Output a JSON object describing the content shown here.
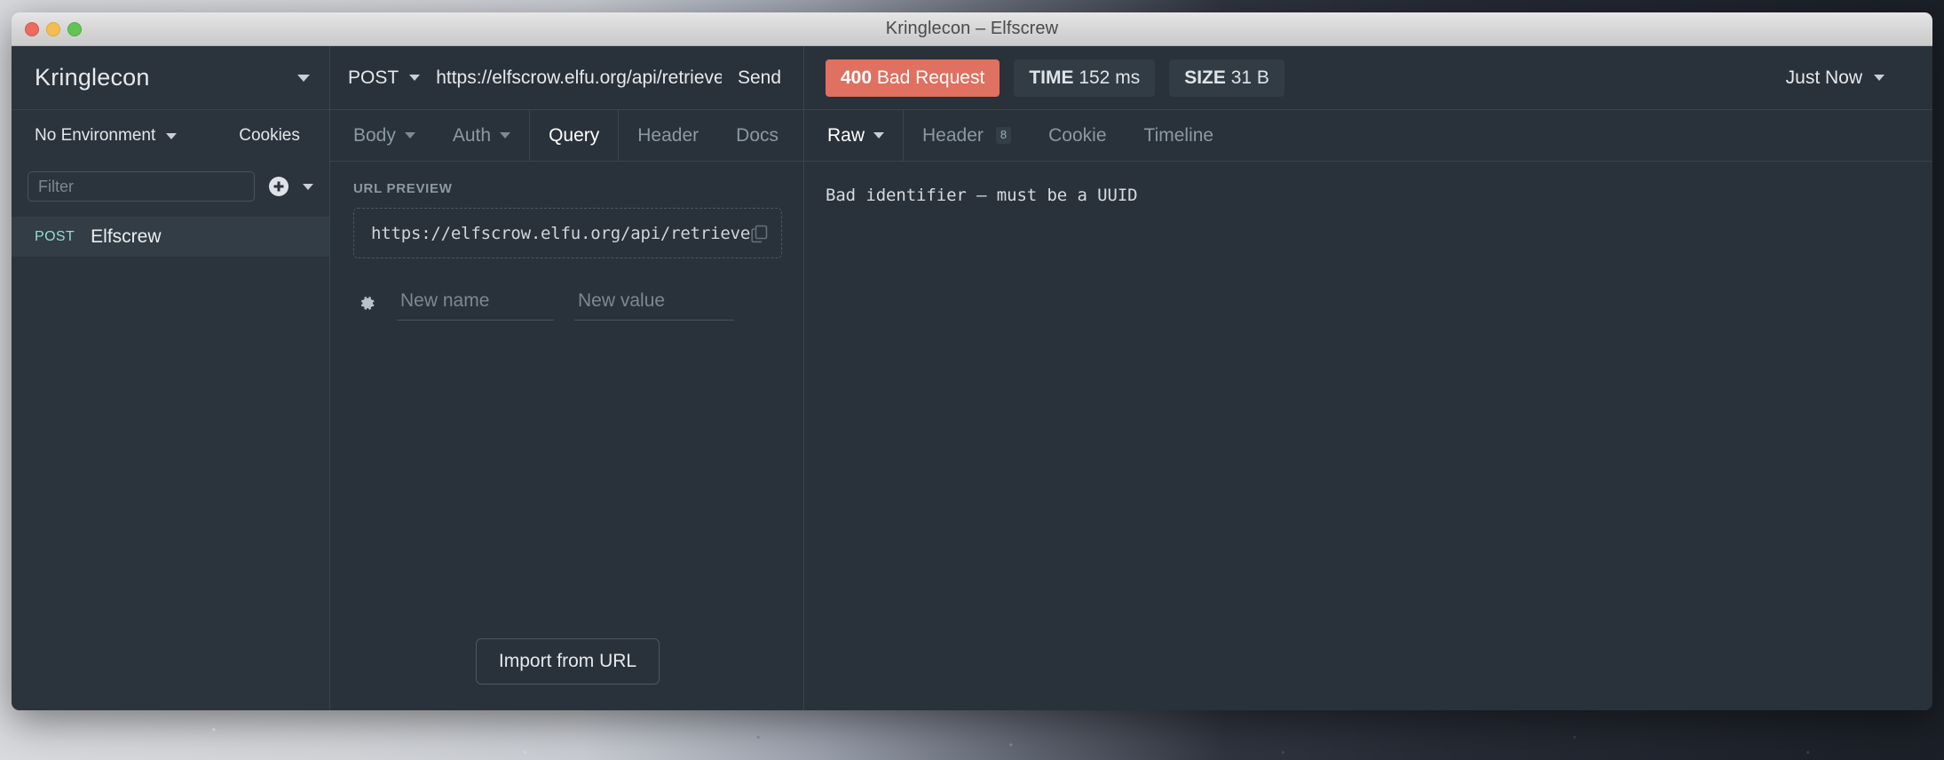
{
  "window": {
    "title": "Kringlecon – Elfscrew",
    "traffic_lights": [
      "close",
      "minimize",
      "zoom"
    ]
  },
  "sidebar": {
    "workspace_name": "Kringlecon",
    "environment": "No Environment",
    "cookies_label": "Cookies",
    "filter_placeholder": "Filter",
    "filter_value": "",
    "requests": [
      {
        "method": "POST",
        "name": "Elfscrew",
        "active": true
      }
    ]
  },
  "request": {
    "method": "POST",
    "url": "https://elfscrow.elfu.org/api/retrieve",
    "send_label": "Send",
    "tabs": [
      {
        "label": "Body",
        "caret": true,
        "active": false
      },
      {
        "label": "Auth",
        "caret": true,
        "active": false
      },
      {
        "label": "Query",
        "caret": false,
        "active": true
      },
      {
        "label": "Header",
        "caret": false,
        "active": false
      },
      {
        "label": "Docs",
        "caret": false,
        "active": false
      }
    ],
    "url_preview_label": "URL PREVIEW",
    "url_preview": "https://elfscrow.elfu.org/api/retrieve",
    "param_name_placeholder": "New name",
    "param_name_value": "",
    "param_value_placeholder": "New value",
    "param_value_value": "",
    "import_button": "Import from URL"
  },
  "response": {
    "status_code": "400",
    "status_text": "Bad Request",
    "time_label": "TIME",
    "time_value": "152 ms",
    "size_label": "SIZE",
    "size_value": "31 B",
    "history_label": "Just Now",
    "tabs": [
      {
        "label": "Raw",
        "caret": true,
        "active": true,
        "badge": ""
      },
      {
        "label": "Header",
        "caret": false,
        "active": false,
        "badge": "8"
      },
      {
        "label": "Cookie",
        "caret": false,
        "active": false,
        "badge": ""
      },
      {
        "label": "Timeline",
        "caret": false,
        "active": false,
        "badge": ""
      }
    ],
    "body": "Bad identifier — must be a UUID"
  },
  "colors": {
    "panel_bg": "#29313a",
    "sidebar_bg": "#2b333c",
    "border": "#3a444e",
    "error_red": "#e0705f",
    "method_teal": "#93ded0",
    "text_primary": "#e6e9ec",
    "text_dim": "#8b99a3"
  }
}
